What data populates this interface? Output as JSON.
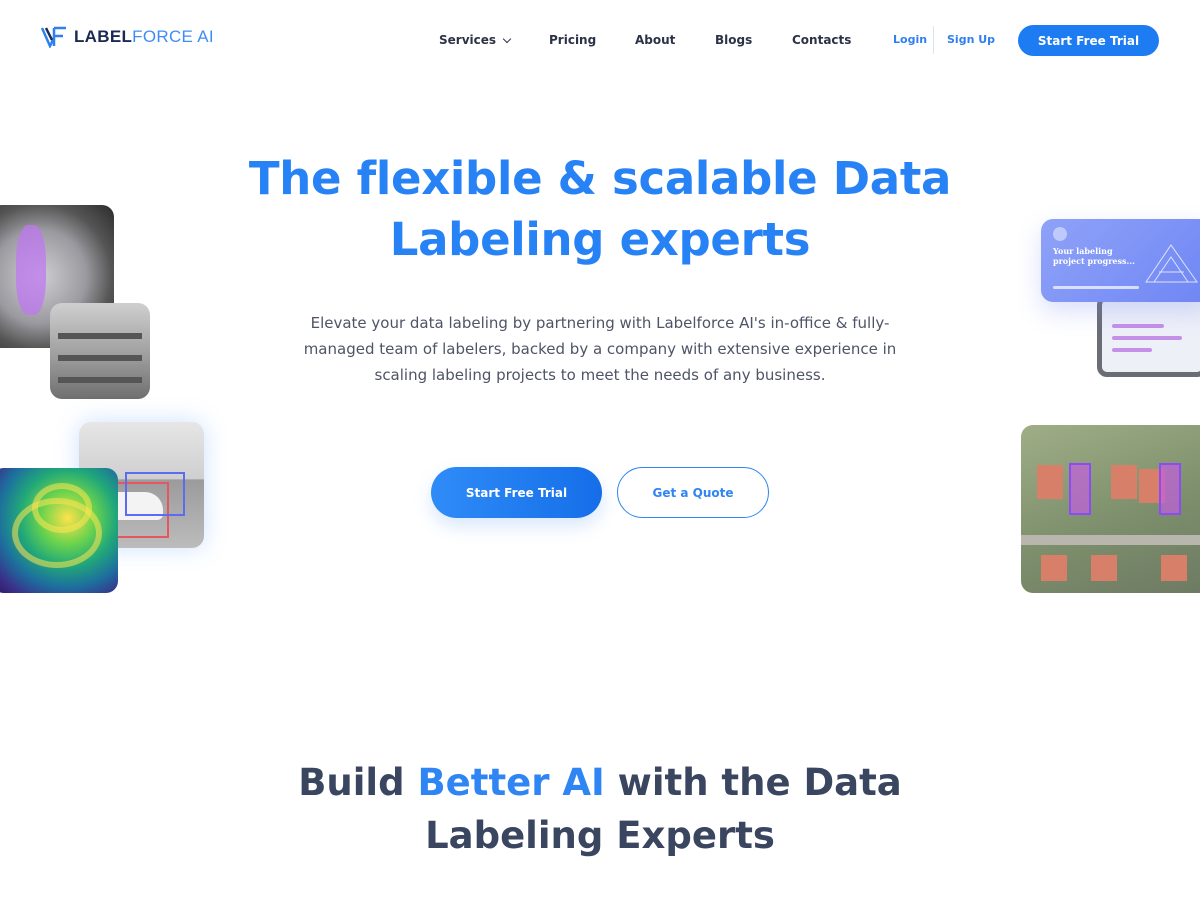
{
  "nav": {
    "logo_part1": "LABEL",
    "logo_part2": "FORCE AI",
    "items": [
      {
        "label": "Services",
        "has_dropdown": true
      },
      {
        "label": "Pricing"
      },
      {
        "label": "About"
      },
      {
        "label": "Blogs"
      },
      {
        "label": "Contacts"
      }
    ],
    "login": "Login",
    "signup": "Sign Up",
    "cta": "Start Free Trial"
  },
  "hero": {
    "title_line1": "The flexible & scalable Data",
    "title_line2": "Labeling experts",
    "subtitle_line1": "Elevate your data labeling by partnering with Labelforce AI's in-office & fully-",
    "subtitle_line2": "managed team of labelers, backed by a company with extensive experience in",
    "subtitle_line3": "scaling labeling projects to meet the needs of any business.",
    "primary_button": "Start Free Trial",
    "secondary_button": "Get a Quote"
  },
  "side_card": {
    "caption_line1": "Your labeling",
    "caption_line2": "project progress..."
  },
  "section2": {
    "part1": "Build ",
    "highlight": "Better AI",
    "part2": " with the Data",
    "line2": "Labeling Experts"
  },
  "colors": {
    "accent": "#2782f5",
    "heading_dark": "#3a4560",
    "body_text": "#4f5466"
  },
  "icons": [
    "logo-icon",
    "chevron-down-icon"
  ]
}
